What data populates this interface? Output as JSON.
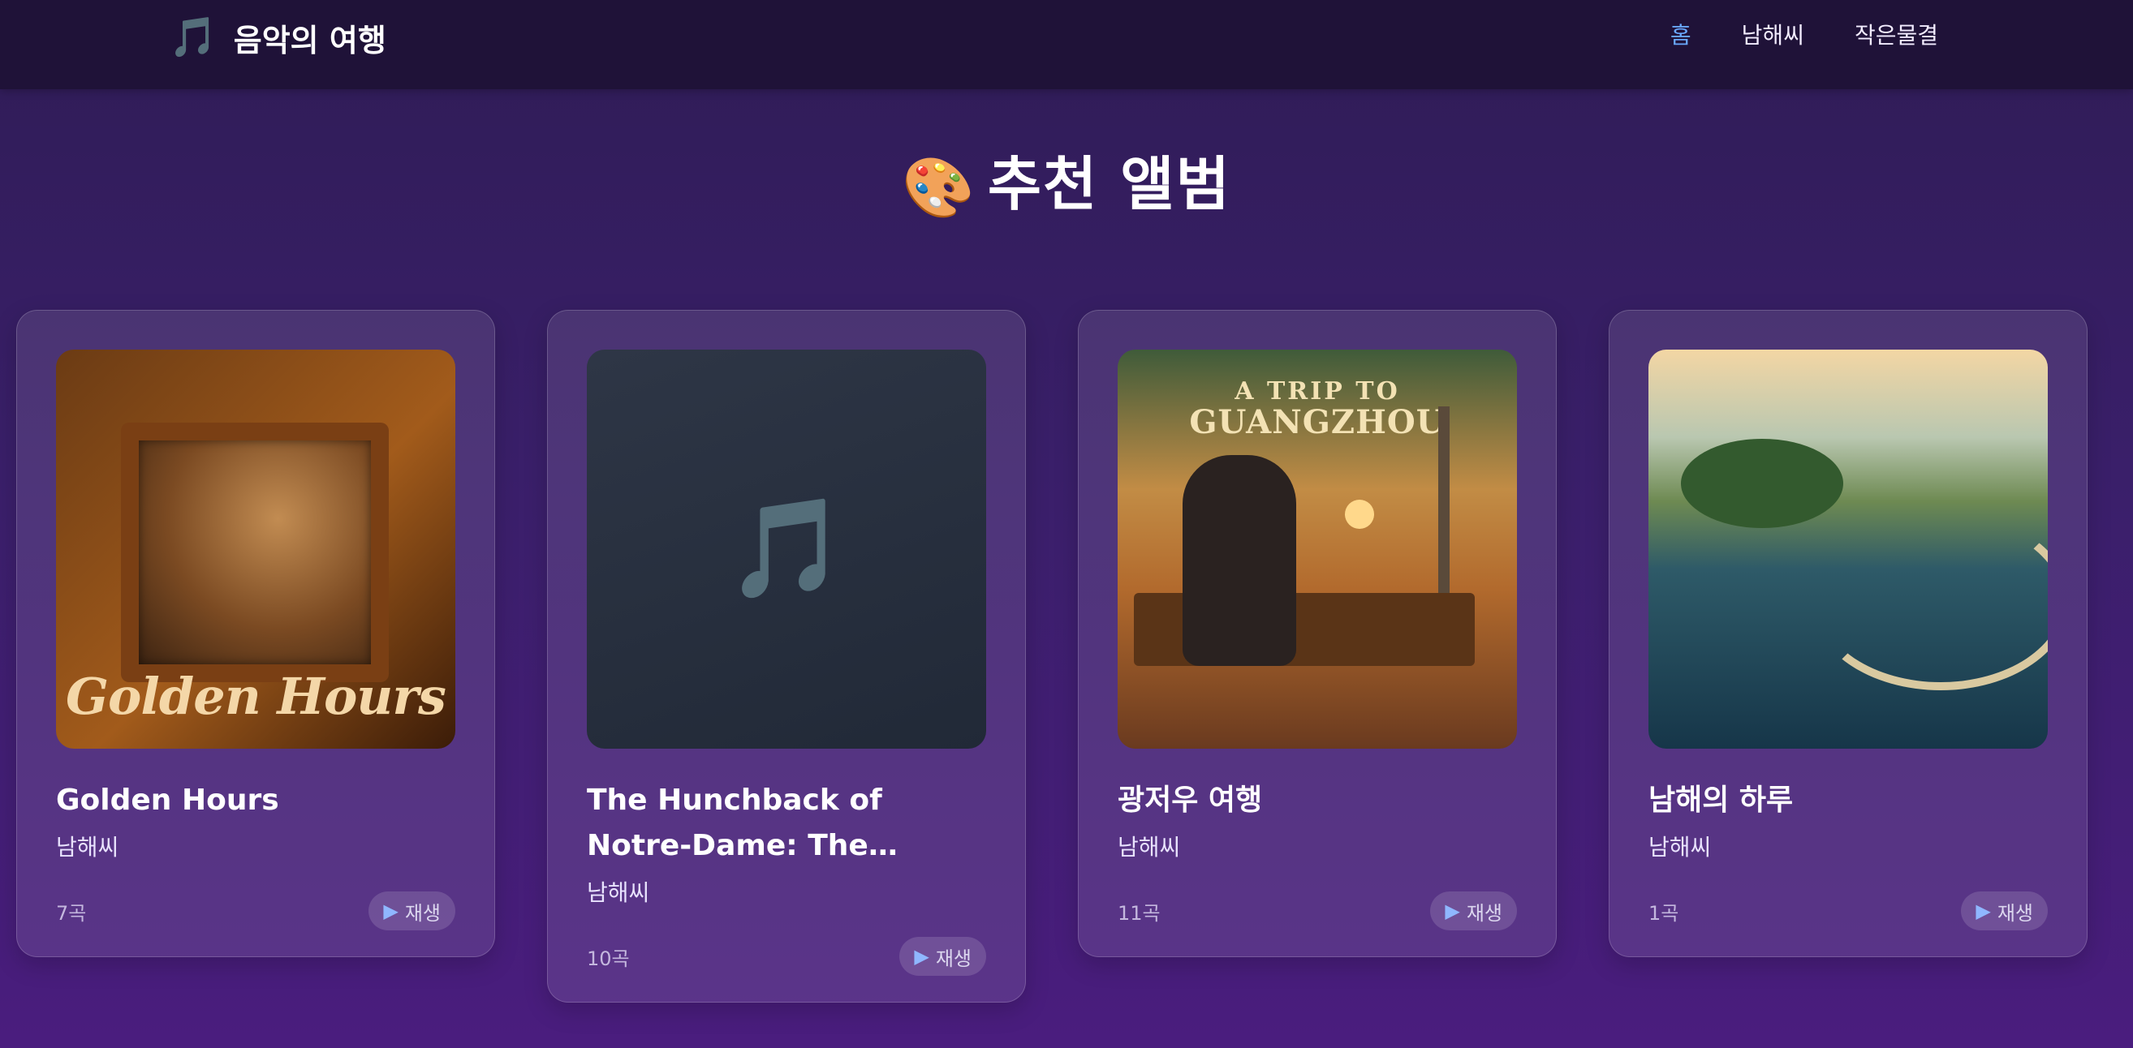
{
  "header": {
    "brand": "음악의 여행",
    "brand_icon": "🎵",
    "nav": [
      "홈",
      "남해씨",
      "작은물결"
    ],
    "active_nav": "홈",
    "accent_color": "#69a8ff"
  },
  "page": {
    "title_icon": "🎨",
    "title": "추천 앨범"
  },
  "albums": [
    {
      "title": "Golden Hours",
      "artist": "남해씨",
      "count": "7곡",
      "play_label": "재생",
      "cover_text": "Golden Hours"
    },
    {
      "title": "The Hunchback of Notre-Dame: The…",
      "artist": "남해씨",
      "count": "10곡",
      "play_label": "재생",
      "cover_icon": "🎵"
    },
    {
      "title": "광저우 여행",
      "artist": "남해씨",
      "count": "11곡",
      "play_label": "재생",
      "cover_text_1": "A TRIP TO",
      "cover_text_2": "GUANGZHOU"
    },
    {
      "title": "남해의 하루",
      "artist": "남해씨",
      "count": "1곡",
      "play_label": "재생"
    }
  ],
  "play_icon": "▶"
}
